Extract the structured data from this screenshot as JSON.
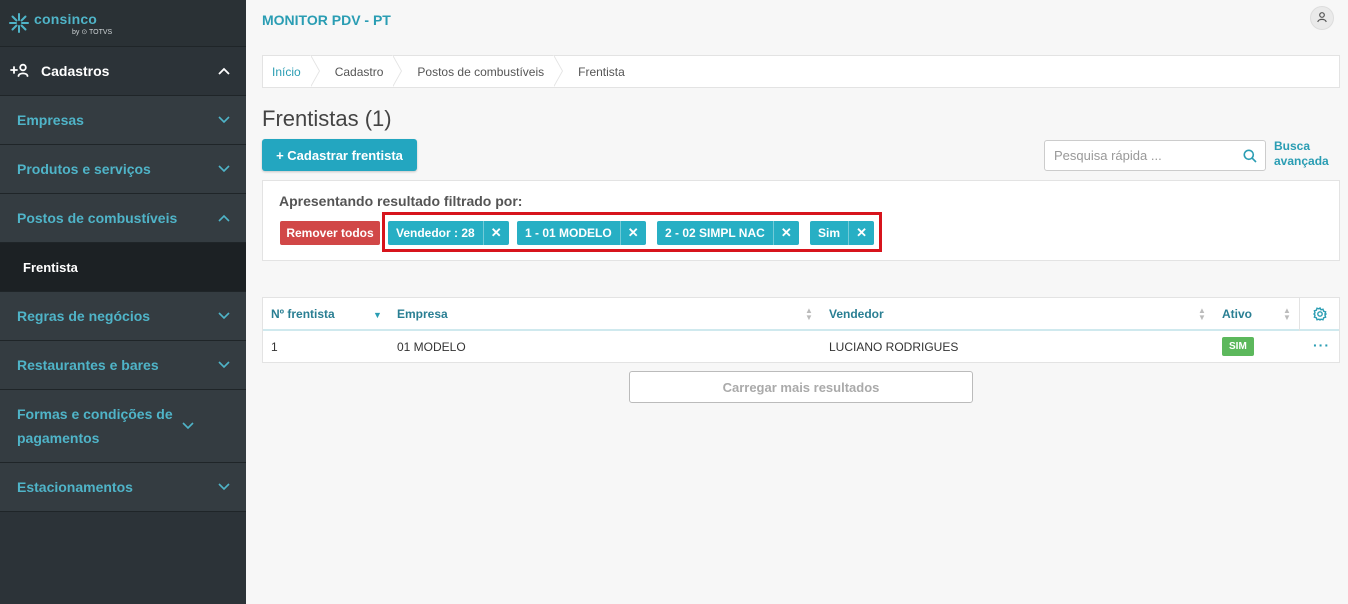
{
  "brand": {
    "name": "consinco",
    "by": "by ⊙ TOTVS"
  },
  "app": {
    "title": "MONITOR PDV - PT"
  },
  "sidebar": {
    "section": {
      "label": "Cadastros",
      "icon": "add-user-icon"
    },
    "items": [
      {
        "label": "Empresas",
        "expanded": false
      },
      {
        "label": "Produtos e serviços",
        "expanded": false
      },
      {
        "label": "Postos de combustíveis",
        "expanded": true
      },
      {
        "label": "Regras de negócios",
        "expanded": false
      },
      {
        "label": "Restaurantes e bares",
        "expanded": false
      },
      {
        "label": "Formas e condições de pagamentos",
        "expanded": false
      },
      {
        "label": "Estacionamentos",
        "expanded": false
      }
    ],
    "active_sub": "Frentista"
  },
  "breadcrumb": [
    "Início",
    "Cadastro",
    "Postos de combustíveis",
    "Frentista"
  ],
  "page": {
    "title": "Frentistas (1)",
    "add_button": "+ Cadastrar frentista",
    "search_placeholder": "Pesquisa rápida ...",
    "advanced_search": "Busca avançada"
  },
  "filters": {
    "title": "Apresentando resultado filtrado por:",
    "remove_all": "Remover todos",
    "chips": [
      {
        "label": "Vendedor : 28",
        "close": "✕"
      },
      {
        "label": "1 - 01 MODELO",
        "close": "✕"
      },
      {
        "label": "2 - 02 SIMPL NAC",
        "close": "✕"
      },
      {
        "label": "Sim",
        "close": "✕"
      }
    ],
    "highlight_color": "#d7141c"
  },
  "table": {
    "columns": [
      "Nº frentista",
      "Empresa",
      "Vendedor",
      "Ativo"
    ],
    "rows": [
      {
        "numero": "1",
        "empresa": "01 MODELO",
        "vendedor": "LUCIANO RODRIGUES",
        "ativo": "SIM"
      }
    ],
    "row_actions": "···"
  },
  "load_more": "Carregar mais resultados",
  "colors": {
    "accent": "#23a6c0",
    "danger": "#d14747",
    "success": "#5cb85c",
    "sidebar_bg": "#2c3338"
  }
}
